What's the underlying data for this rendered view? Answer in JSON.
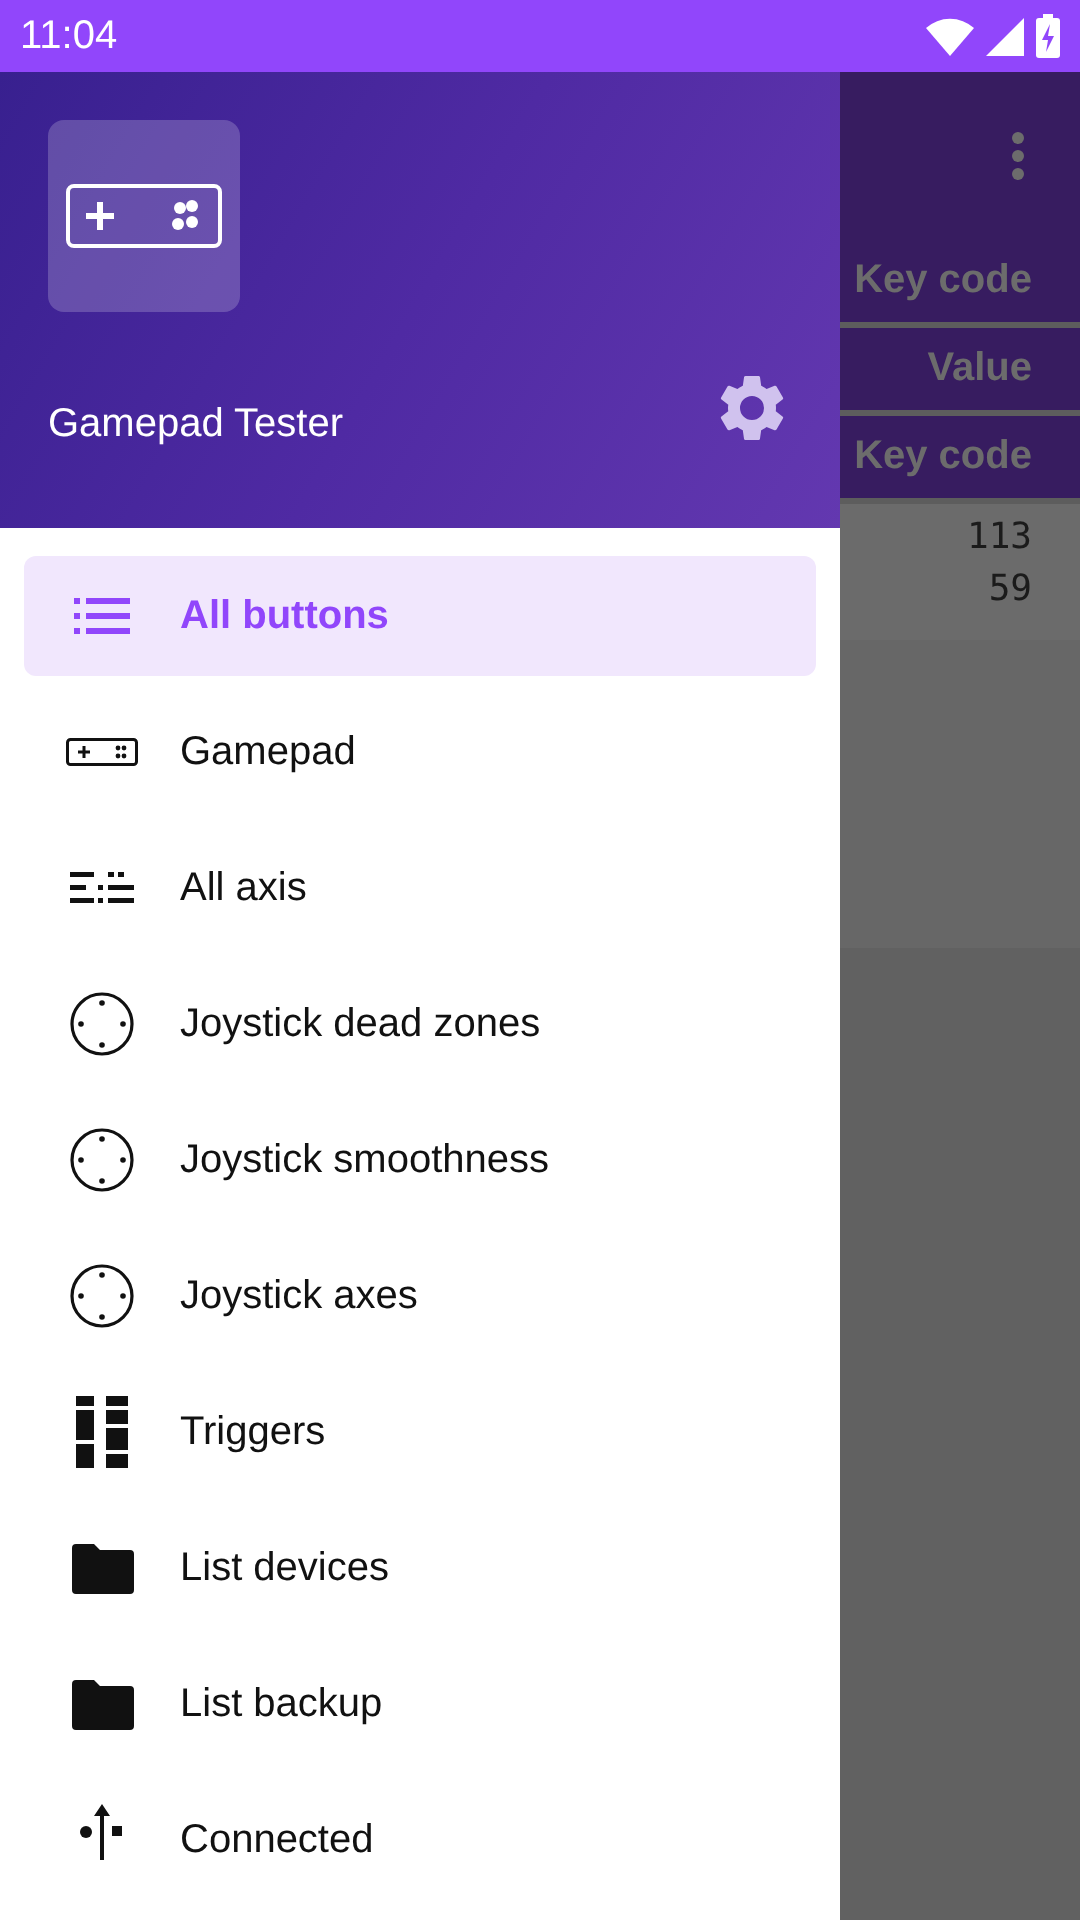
{
  "status_bar": {
    "time": "11:04"
  },
  "drawer": {
    "app_name": "Gamepad Tester",
    "items": [
      {
        "label": "All buttons",
        "kind": "list",
        "selected": true
      },
      {
        "label": "Gamepad",
        "kind": "gamepad",
        "selected": false
      },
      {
        "label": "All axis",
        "kind": "axis",
        "selected": false
      },
      {
        "label": "Joystick dead zones",
        "kind": "joystick",
        "selected": false
      },
      {
        "label": "Joystick smoothness",
        "kind": "joystick",
        "selected": false
      },
      {
        "label": "Joystick axes",
        "kind": "joystick",
        "selected": false
      },
      {
        "label": "Triggers",
        "kind": "triggers",
        "selected": false
      },
      {
        "label": "List devices",
        "kind": "folder",
        "selected": false
      },
      {
        "label": "List backup",
        "kind": "folder",
        "selected": false
      },
      {
        "label": "Connected",
        "kind": "usb",
        "selected": false
      }
    ]
  },
  "background": {
    "headers": [
      "Key code",
      "Value",
      "Key code"
    ],
    "values": [
      "113",
      "59"
    ]
  }
}
